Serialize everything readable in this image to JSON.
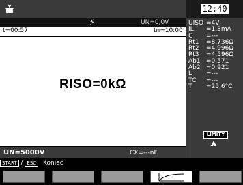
{
  "header": {
    "time": "12:40"
  },
  "measurement": {
    "un_display": "UN=0,0V",
    "t_elapsed": "t=00:57",
    "t_n": "tn=10:00",
    "result": "RISO=0kΩ"
  },
  "params": [
    {
      "k": "UISO",
      "v": "=4V"
    },
    {
      "k": "IL",
      "v": "=1,3mA"
    },
    {
      "k": "C",
      "v": "=---"
    },
    {
      "k": "Rt1",
      "v": "=8,736Ω"
    },
    {
      "k": "Rt2",
      "v": "=4,996Ω"
    },
    {
      "k": "Rt3",
      "v": "=4,596Ω"
    },
    {
      "k": "Ab1",
      "v": "=0,571"
    },
    {
      "k": "Ab2",
      "v": "=0,921"
    },
    {
      "k": "L",
      "v": "=---"
    },
    {
      "k": "TC",
      "v": "=---"
    },
    {
      "k": "T",
      "v": "=25,6°C"
    }
  ],
  "limits_label": "LIMITY",
  "status": {
    "un": "UN=5000V",
    "cx": "CX=---nF"
  },
  "hint": {
    "start_key": "START",
    "esc_key": "ESC",
    "action": "Koniec"
  },
  "function_keys": [
    "",
    "",
    "",
    "",
    ""
  ],
  "colors": {
    "background": "#000000",
    "panel": "#3a3a3a",
    "screen": "#ffffff",
    "key": "#9a9a9a"
  }
}
